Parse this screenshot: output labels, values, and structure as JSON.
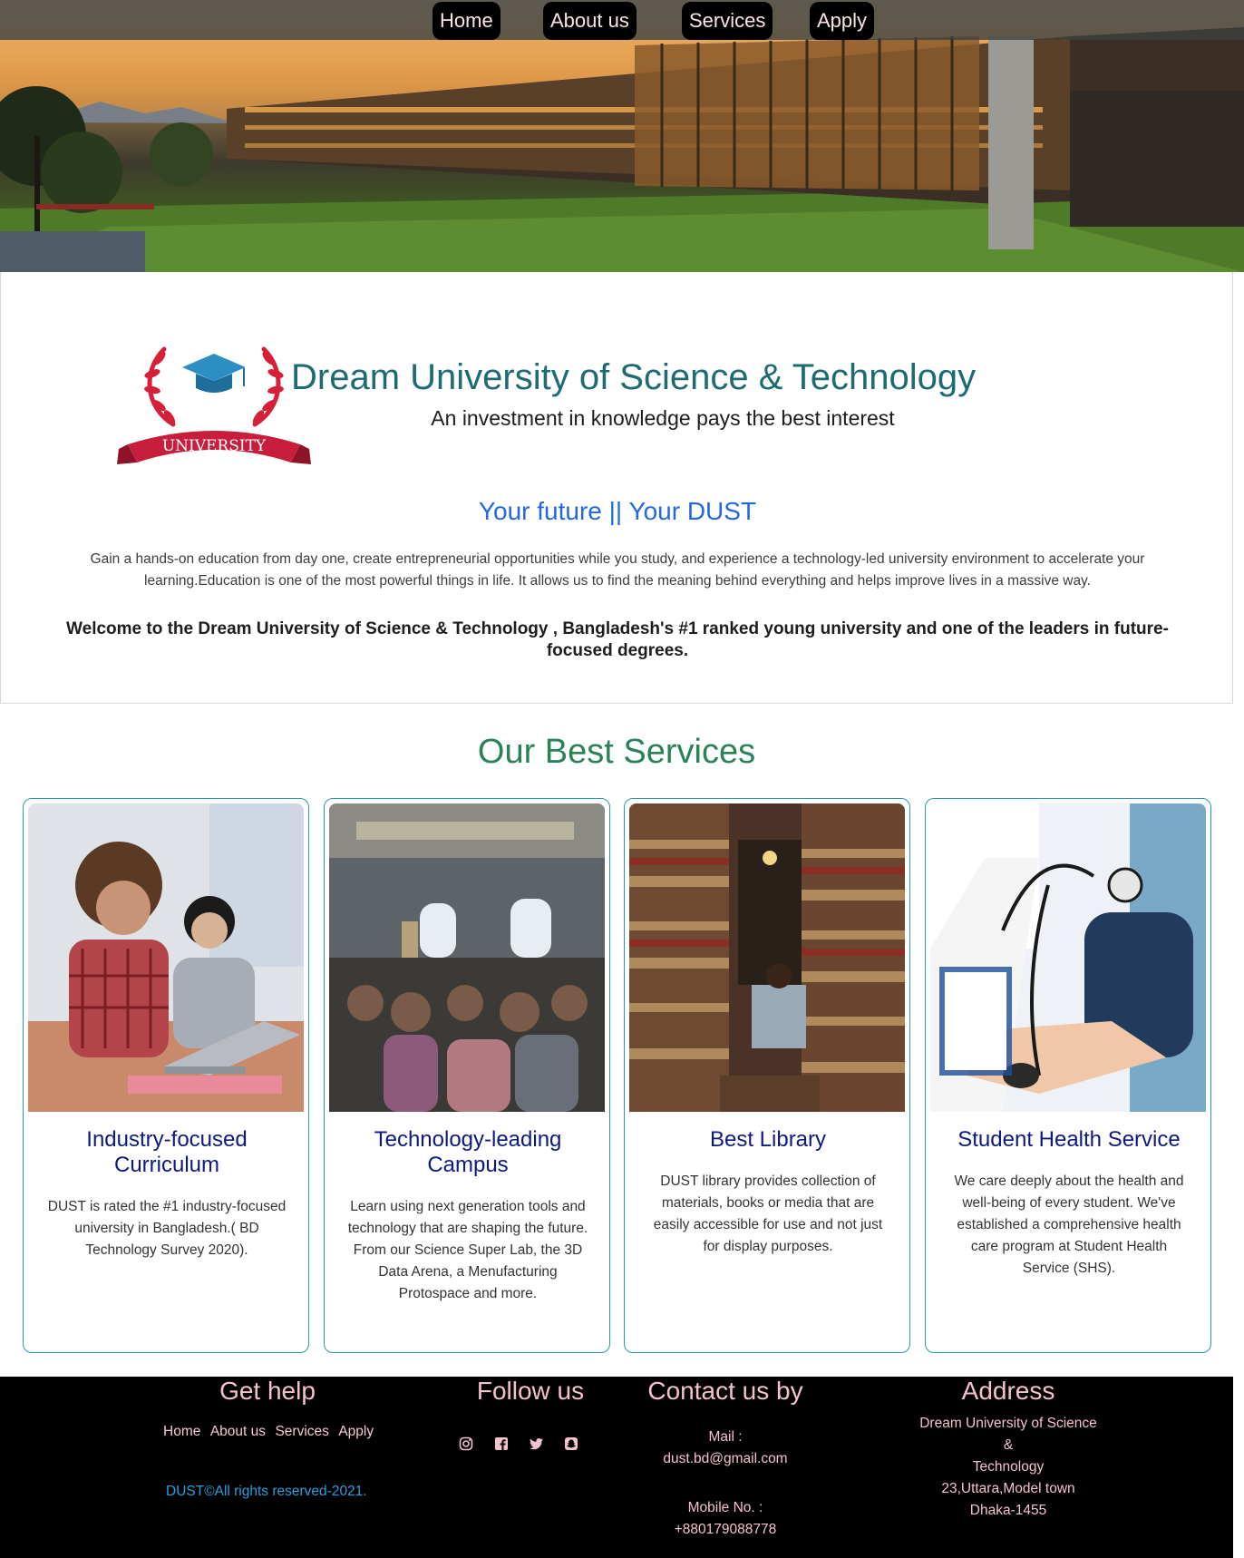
{
  "nav": {
    "items": [
      "Home",
      "About us",
      "Services",
      "Apply"
    ]
  },
  "header": {
    "title": "Dream University of Science & Technology",
    "tagline": "An investment in knowledge pays the best interest",
    "logo_text": "UNIVERSITY"
  },
  "intro": {
    "heading": "Your future || Your DUST",
    "paragraph": "Gain a hands-on education from day one, create entrepreneurial opportunities while you study, and experience a technology-led university environment to accelerate your learning.Education is one of the most powerful things in life. It allows us to find the meaning behind everything and helps improve lives in a massive way.",
    "welcome": "Welcome to the Dream University of Science & Technology , Bangladesh's #1 ranked young university and one of the leaders in future-focused degrees."
  },
  "services": {
    "title": "Our Best Services",
    "cards": [
      {
        "title": "Industry-focused Curriculum",
        "text": "DUST is rated the #1 industry-focused university in Bangladesh.( BD Technology Survey 2020).",
        "image": "students-laptop-photo"
      },
      {
        "title": "Technology-leading Campus",
        "text": "Learn using next generation tools and technology that are shaping the future. From our Science Super Lab, the 3D Data Arena, a Menufacturing Protospace and more.",
        "image": "classroom-photo"
      },
      {
        "title": "Best Library",
        "text": "DUST library provides collection of materials, books or media that are easily accessible for use and not just for display purposes.",
        "image": "library-books-photo"
      },
      {
        "title": "Student Health Service",
        "text": "We care deeply about the health and well-being of every student. We've established a comprehensive health care program at Student Health Service (SHS).",
        "image": "blood-pressure-photo"
      }
    ]
  },
  "footer": {
    "get_help": {
      "heading": "Get help",
      "links": [
        "Home",
        "About us",
        "Services",
        "Apply"
      ],
      "copyright": "DUST©All rights reserved-2021."
    },
    "follow": {
      "heading": "Follow us",
      "icons": [
        "instagram-icon",
        "facebook-icon",
        "twitter-icon",
        "snapchat-icon"
      ]
    },
    "contact": {
      "heading": "Contact us by",
      "mail_label": "Mail :",
      "mail": "dust.bd@gmail.com",
      "mobile_label": "Mobile No. :",
      "mobile": "+880179088778"
    },
    "address": {
      "heading": "Address",
      "line1": "Dream University of Science",
      "line2": "&",
      "line3": "Technology",
      "line4": "23,Uttara,Model town",
      "line5": "Dhaka-1455"
    }
  },
  "colors": {
    "title_teal": "#1e6b72",
    "link_blue": "#2368e0",
    "services_green": "#2a8257",
    "card_border": "#2a9ba4",
    "card_title_navy": "#0a1a80",
    "footer_pink": "#f4c2cc"
  }
}
